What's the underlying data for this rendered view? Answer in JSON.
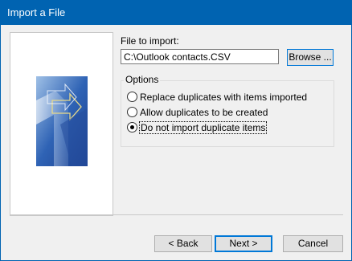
{
  "window": {
    "title": "Import a File"
  },
  "file": {
    "label": "File to import:",
    "value": "C:\\Outlook contacts.CSV",
    "browse_label": "Browse ..."
  },
  "options": {
    "title": "Options",
    "items": [
      {
        "label": "Replace duplicates with items imported",
        "checked": false
      },
      {
        "label": "Allow duplicates to be created",
        "checked": false
      },
      {
        "label": "Do not import duplicate items",
        "checked": true
      }
    ]
  },
  "buttons": {
    "back": "< Back",
    "next": "Next >",
    "cancel": "Cancel"
  },
  "colors": {
    "title_bar": "#0063b1",
    "focus_border": "#0078d7"
  }
}
